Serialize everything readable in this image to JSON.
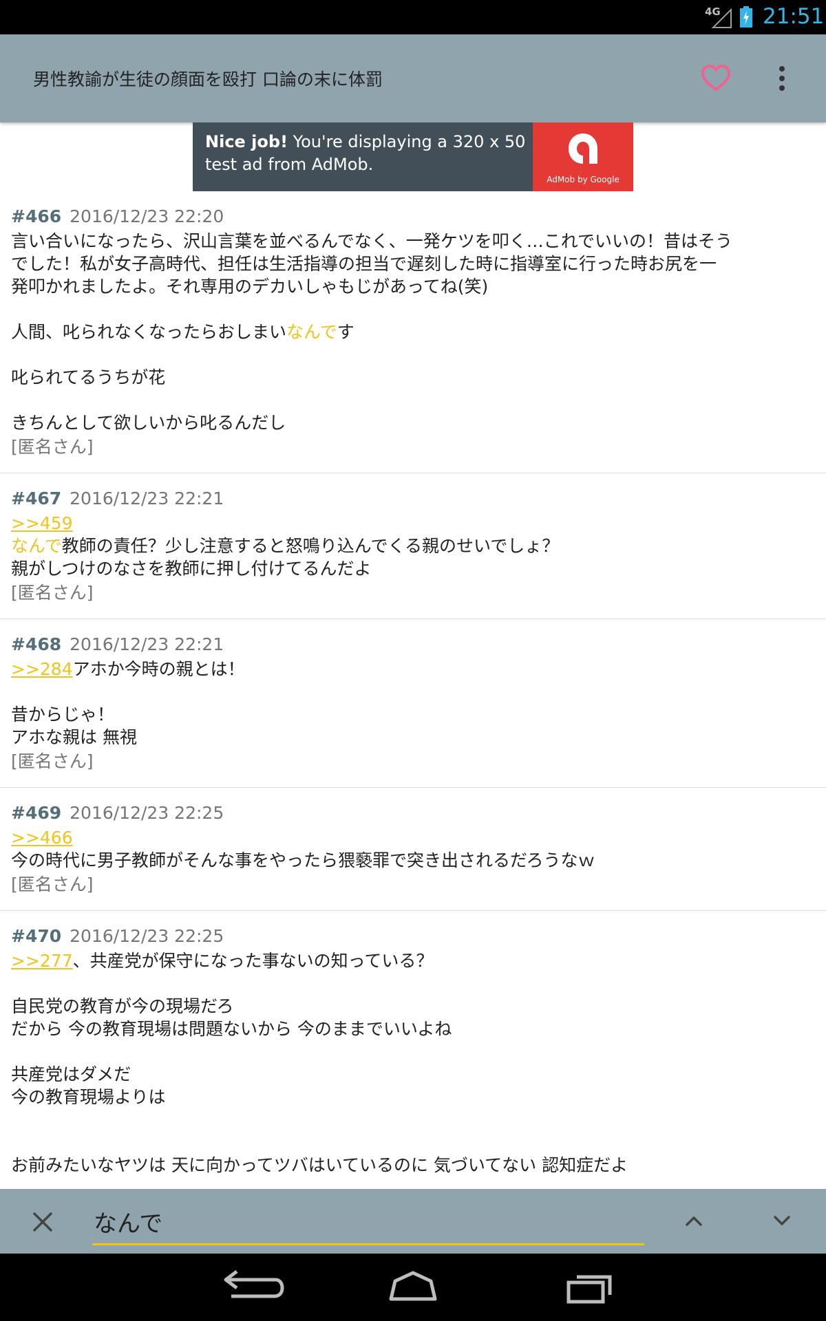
{
  "status_bar": {
    "network": "4G",
    "time": "21:51"
  },
  "app_bar": {
    "title": "男性教諭が生徒の顔面を殴打 口論の末に体罰"
  },
  "ad": {
    "headline": "Nice job!",
    "text": " You're displaying a 320 x 50 test ad from AdMob.",
    "brand": "AdMob by Google"
  },
  "posts": [
    {
      "num": "#466",
      "date": "2016/12/23 22:20",
      "lines": [
        {
          "pre": "言い合いになったら、沢山言葉を並べるんでなく、一発ケツを叩く…これでいいの！昔はそう"
        },
        {
          "pre": "でした！私が女子高時代、担任は生活指導の担当で遅刻した時に指導室に行った時お尻を一"
        },
        {
          "pre": "発叩かれましたよ。それ専用のデカいしゃもじがあってね(笑)"
        },
        {
          "pre": ""
        },
        {
          "pre": "人間、叱られなくなったらおしまい",
          "hl": "なんで",
          "post": "す"
        },
        {
          "pre": ""
        },
        {
          "pre": "叱られてるうちが花"
        },
        {
          "pre": ""
        },
        {
          "pre": "きちんとして欲しいから叱るんだし"
        }
      ],
      "author": "[匿名さん]"
    },
    {
      "num": "#467",
      "date": "2016/12/23 22:21",
      "lines": [
        {
          "anchor": ">>459"
        },
        {
          "hl": "なんで",
          "post": "教師の責任？少し注意すると怒鳴り込んでくる親のせいでしょ？"
        },
        {
          "pre": "親がしつけのなさを教師に押し付けてるんだよ"
        }
      ],
      "author": "[匿名さん]"
    },
    {
      "num": "#468",
      "date": "2016/12/23 22:21",
      "lines": [
        {
          "anchor": ">>284",
          "post": "アホか今時の親とは！"
        },
        {
          "pre": ""
        },
        {
          "pre": "昔からじゃ！"
        },
        {
          "pre": "アホな親は 無視"
        }
      ],
      "author": "[匿名さん]"
    },
    {
      "num": "#469",
      "date": "2016/12/23 22:25",
      "lines": [
        {
          "anchor": ">>466"
        },
        {
          "pre": "今の時代に男子教師がそんな事をやったら猥褻罪で突き出されるだろうなｗ"
        }
      ],
      "author": "[匿名さん]"
    },
    {
      "num": "#470",
      "date": "2016/12/23 22:25",
      "lines": [
        {
          "anchor": ">>277",
          "post": "、共産党が保守になった事ないの知っている？"
        },
        {
          "pre": ""
        },
        {
          "pre": "自民党の教育が今の現場だろ"
        },
        {
          "pre": "だから 今の教育現場は問題ないから 今のままでいいよね"
        },
        {
          "pre": ""
        },
        {
          "pre": "共産党はダメだ"
        },
        {
          "pre": "今の教育現場よりは"
        },
        {
          "pre": ""
        },
        {
          "pre": ""
        },
        {
          "pre": "お前みたいなヤツは 天に向かってツバはいているのに 気づいてない 認知症だよ"
        }
      ],
      "author": ""
    }
  ],
  "search": {
    "value": "なんで"
  },
  "colors": {
    "highlight": "#f0c419",
    "app_bar": "#90a4ae",
    "favorite": "#f06292",
    "post_number": "#546e7a"
  },
  "icons": {
    "favorite": "heart-icon",
    "more": "more-vert-icon",
    "close": "close-icon",
    "prev": "chevron-up-icon",
    "next": "chevron-down-icon"
  }
}
